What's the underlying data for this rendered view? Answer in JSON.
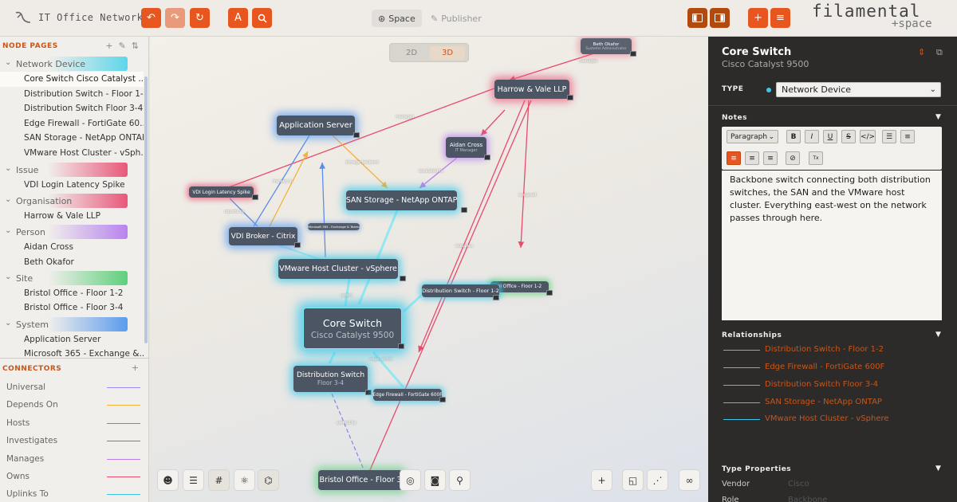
{
  "app": {
    "title": "IT Office Network",
    "brand": "filamental",
    "brand_sub": "+space"
  },
  "modes": {
    "space": "Space",
    "publisher": "Publisher"
  },
  "sidebar": {
    "node_pages_header": "NODE PAGES",
    "groups": [
      {
        "label": "Network Device",
        "color": "#5ed6ea",
        "items": [
          "Core Switch Cisco Catalyst ...",
          "Distribution Switch - Floor 1-2",
          "Distribution Switch Floor 3-4",
          "Edge Firewall - FortiGate 60...",
          "SAN Storage - NetApp ONTAP",
          "VMware Host Cluster - vSph..."
        ]
      },
      {
        "label": "Issue",
        "color": "#e8587a",
        "items": [
          "VDI Login Latency Spike"
        ]
      },
      {
        "label": "Organisation",
        "color": "#e8587a",
        "items": [
          "Harrow & Vale LLP"
        ]
      },
      {
        "label": "Person",
        "color": "#b784ee",
        "items": [
          "Aidan Cross",
          "Beth Okafor"
        ]
      },
      {
        "label": "Site",
        "color": "#5fcf7e",
        "items": [
          "Bristol Office - Floor 1-2",
          "Bristol Office - Floor 3-4"
        ]
      },
      {
        "label": "System",
        "color": "#5b9bee",
        "items": [
          "Application Server",
          "Microsoft 365 - Exchange &..."
        ]
      }
    ],
    "connectors_header": "CONNECTORS",
    "connectors": [
      {
        "label": "Universal",
        "color": "#9a8bf0"
      },
      {
        "label": "Depends On",
        "color": "#f2b33a"
      },
      {
        "label": "Hosts",
        "color": "#5b8bee"
      },
      {
        "label": "Investigates",
        "color": "#e84a6a"
      },
      {
        "label": "Manages",
        "color": "#c07be8"
      },
      {
        "label": "Owns",
        "color": "#e84a6a"
      },
      {
        "label": "Uplinks To",
        "color": "#3cc7e8"
      }
    ]
  },
  "canvas": {
    "view_2d": "2D",
    "view_3d": "3D",
    "nodes": {
      "beth": {
        "title": "Beth Okafor",
        "sub": "Systems Administrator"
      },
      "harrow": {
        "title": "Harrow & Vale LLP"
      },
      "appserver": {
        "title": "Application Server"
      },
      "aidan": {
        "title": "Aidan Cross",
        "sub": "IT Manager"
      },
      "vdi_issue": {
        "title": "VDI Login Latency Spike"
      },
      "san": {
        "title": "SAN Storage - NetApp ONTAP"
      },
      "ms365": {
        "title": "Microsoft 365 - Exchange & Teams"
      },
      "vdi_broker": {
        "title": "VDI Broker - Citrix"
      },
      "vmware": {
        "title": "VMware Host Cluster - vSphere"
      },
      "dist12": {
        "title": "Distribution Switch - Floor 1-2"
      },
      "bristol12": {
        "title": "ol Office - Floor 1-2"
      },
      "core": {
        "title": "Core Switch",
        "sub": "Cisco Catalyst 9500"
      },
      "dist34": {
        "title": "Distribution Switch",
        "sub": "Floor 3-4"
      },
      "edge": {
        "title": "Edge Firewall - FortiGate 600F"
      },
      "bristol34": {
        "title": "Bristol Office - Floor 3"
      }
    },
    "edge_labels": {
      "manages": "manages",
      "storage": "storage backend",
      "escalated": "escalated to",
      "tracked": "tracked in",
      "reports": "reports by",
      "assigned": "assigned",
      "uplink": "uplink",
      "occupies": "occupies",
      "edge_uplink": "edge uplink",
      "served": "served by"
    }
  },
  "panel": {
    "title": "Core Switch",
    "subtitle": "Cisco Catalyst 9500",
    "type_label": "TYPE",
    "type_value": "Network Device",
    "notes_label": "Notes",
    "format_select": "Paragraph",
    "notes_text": "Backbone switch connecting both distribution switches, the SAN and the VMware host cluster. Everything east-west on the network passes through here.",
    "relationships_label": "Relationships",
    "relationships": [
      "Distribution Switch - Floor 1-2",
      "Edge Firewall - FortiGate 600F",
      "Distribution Switch Floor 3-4",
      "SAN Storage - NetApp ONTAP",
      "VMware Host Cluster - vSphere"
    ],
    "type_props_label": "Type Properties",
    "props": [
      {
        "key": "Vendor",
        "value": "Cisco"
      },
      {
        "key": "Role",
        "value": "Backbone"
      }
    ]
  }
}
